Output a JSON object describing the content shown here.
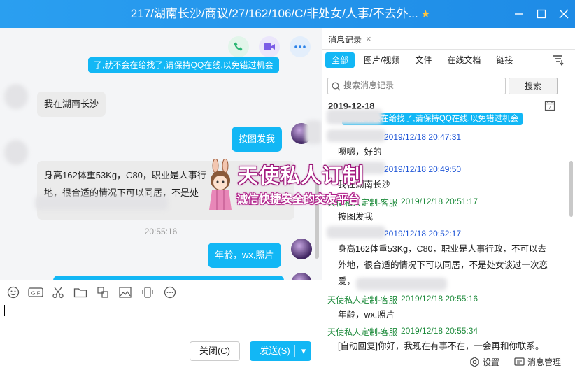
{
  "window": {
    "title": "217/湖南长沙/商议/27/162/106/C/非处女/人事/不去外...",
    "star": "★"
  },
  "chat": {
    "top_snippet": "了,就不会在给找了,请保持QQ在线,以免错过机会",
    "messages": [
      {
        "dir": "in",
        "text": "我在湖南长沙"
      },
      {
        "dir": "out",
        "text": "按图发我"
      },
      {
        "dir": "in",
        "text": "身高162体重53Kg，C80，职业是人事行政，不可以去外地，很合适的情况下可以同居，不是处女谈过一次恋爱，QQ"
      },
      {
        "dir": "out",
        "text": "年龄，wx,照片"
      }
    ],
    "line1": "身高162体重53Kg，C80，职业是人事行",
    "line2": "地，很合适的情况下可以同居，不是处",
    "timestamp": "20:55:16"
  },
  "composer": {
    "close_label": "关闭(C)",
    "send_label": "发送(S)",
    "send_dropdown": "▾"
  },
  "history": {
    "tab_label": "消息记录",
    "tab_close": "×",
    "filters": [
      "全部",
      "图片/视频",
      "文件",
      "在线文档",
      "链接"
    ],
    "search_placeholder": "搜索消息记录",
    "search_button": "搜索",
    "date": "2019-12-18",
    "snippet": "了,就不会在给找了,请保持QQ在线,以免错过机会",
    "entries": [
      {
        "sender": "",
        "time": "2019/12/18 20:47:31",
        "text": "嗯嗯，好的"
      },
      {
        "sender": "",
        "time": "2019/12/18 20:49:50",
        "text": "我在湖南长沙"
      },
      {
        "sender": "天使私人定制-客服",
        "time": "2019/12/18 20:51:17",
        "text": "按图发我"
      },
      {
        "sender": "",
        "time": "2019/12/18 20:52:17",
        "text": "身高162体重53Kg，C80，职业是人事行政，不可以去外地，很合适的情况下可以同居，不是处女谈过一次恋爱，"
      },
      {
        "sender": "天使私人定制-客服",
        "time": "2019/12/18 20:55:16",
        "text": "年龄，wx,照片"
      },
      {
        "sender": "天使私人定制-客服",
        "time": "2019/12/18 20:55:34",
        "text": "[自动回复]你好，我现在有事不在，一会再和你联系。"
      }
    ],
    "msg4_line1": "身高162体重53Kg，C80，职业是人事行政，不可以去",
    "msg4_line2": "外地，很合适的情况下可以同居，不是处女谈过一次恋",
    "msg4_line3": "爱，",
    "settings_label": "设置",
    "manage_label": "消息管理"
  },
  "watermark": {
    "title": "天使私人订制",
    "subtitle": "诚信快捷安全的交友平台"
  },
  "colors": {
    "titlebar": "#1e8be6",
    "bubble_out": "#12b7f5",
    "bubble_in": "#ebebeb",
    "link_time": "#1e55d6",
    "sender_green": "#1c8a3a"
  },
  "icons": [
    "phone-icon",
    "video-icon",
    "more-icon",
    "emoji-icon",
    "gif-icon",
    "scissors-icon",
    "folder-icon",
    "screenshot-icon",
    "image-icon",
    "shake-icon",
    "more-options-icon",
    "history-clock-icon",
    "search-icon",
    "filter-icon",
    "calendar-icon",
    "settings-icon",
    "message-manage-icon"
  ]
}
